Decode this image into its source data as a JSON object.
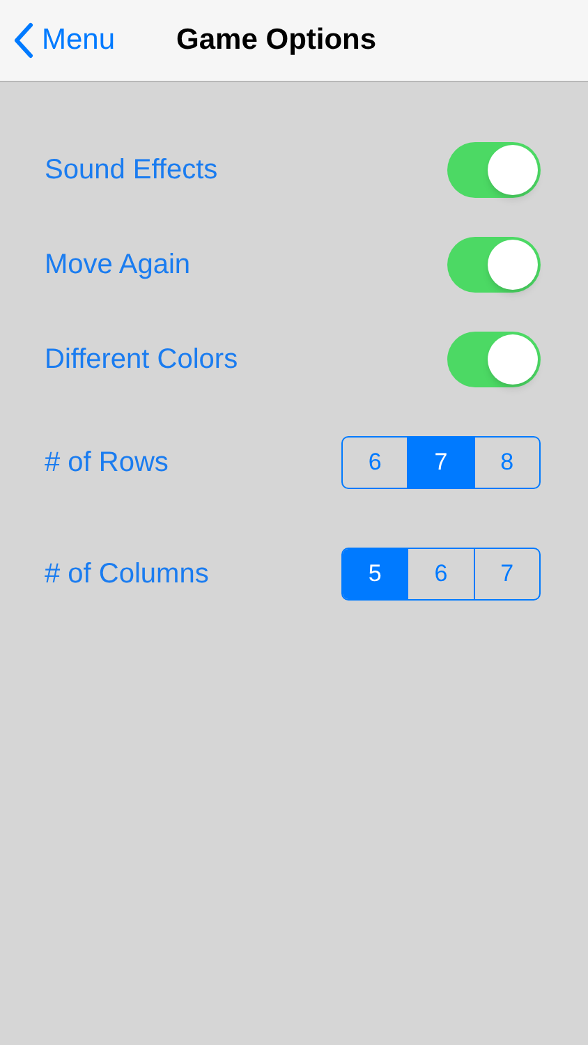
{
  "nav": {
    "back": "Menu",
    "title": "Game Options"
  },
  "options": [
    {
      "kind": "toggle",
      "label": "Sound Effects",
      "on": true
    },
    {
      "kind": "toggle",
      "label": "Move Again",
      "on": true
    },
    {
      "kind": "toggle",
      "label": "Different Colors",
      "on": true
    },
    {
      "kind": "segmented",
      "label": "# of Rows",
      "segments": [
        {
          "label": "6",
          "selected": false
        },
        {
          "label": "7",
          "selected": true
        },
        {
          "label": "8",
          "selected": false
        }
      ]
    },
    {
      "kind": "segmented",
      "label": "# of Columns",
      "segments": [
        {
          "label": "5",
          "selected": true
        },
        {
          "label": "6",
          "selected": false
        },
        {
          "label": "7",
          "selected": false
        }
      ]
    }
  ]
}
